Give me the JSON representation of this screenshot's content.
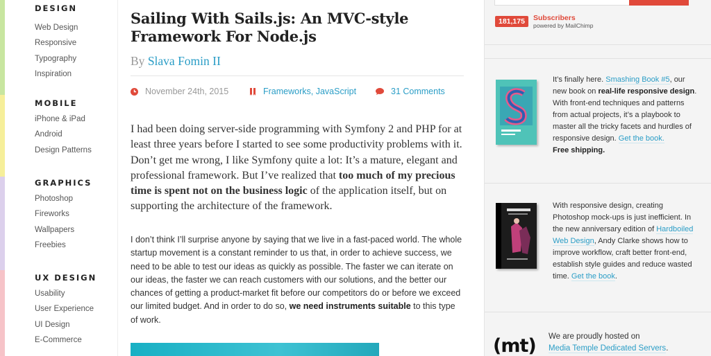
{
  "sidebar": {
    "sections": [
      {
        "heading": "DESIGN",
        "items": [
          "Web Design",
          "Responsive",
          "Typography",
          "Inspiration"
        ]
      },
      {
        "heading": "MOBILE",
        "items": [
          "iPhone & iPad",
          "Android",
          "Design Patterns"
        ]
      },
      {
        "heading": "GRAPHICS",
        "items": [
          "Photoshop",
          "Fireworks",
          "Wallpapers",
          "Freebies"
        ]
      },
      {
        "heading": "UX DESIGN",
        "items": [
          "Usability",
          "User Experience",
          "UI Design",
          "E-Commerce"
        ]
      }
    ],
    "colors": [
      "#c8e6a0",
      "#f6ef9a",
      "#dcd0ec",
      "#f6c3c8"
    ]
  },
  "article": {
    "title": "Sailing With Sails.js: An MVC-style Framework For Node.js",
    "by": "By",
    "author": "Slava Fomin II",
    "date": "November 24th, 2015",
    "categories": [
      "Frameworks",
      "JavaScript"
    ],
    "category_sep": ", ",
    "comments": "31 Comments",
    "lead_part1": "I had been doing server-side programming with Symfony 2 and PHP for at least three years before I started to see some productivity problems with it. Don’t get me wrong, I like Symfony quite a lot: It’s a mature, elegant and professional framework. But I’ve realized that ",
    "lead_bold": "too much of my precious time is spent not on the business logic",
    "lead_part2": " of the application itself, but on supporting the architecture of the framework.",
    "para_part1": "I don’t think I’ll surprise anyone by saying that we live in a fast-paced world. The whole startup movement is a constant reminder to us that, in order to achieve success, we need to be able to test our ideas as quickly as possible. The faster we can iterate on our ideas, the faster we can reach customers with our solutions, and the better our chances of getting a product-market fit before our competitors do or before we exceed our limited budget. And in order to do so, ",
    "para_bold": "we need instruments suitable",
    "para_part2": " to this type of work."
  },
  "newsletter": {
    "count": "181,175",
    "label": "Subscribers",
    "powered": "powered by MailChimp"
  },
  "promo1": {
    "p1": "It’s finally here. ",
    "link1": "Smashing Book #5",
    "p2": ", our new book on ",
    "bold1": "real-life responsive design",
    "p3": ". With front-end techniques and patterns from actual projects, it’s a playbook to master all the tricky facets and hurdles of responsive design. ",
    "link2": "Get the book.",
    "bold2": "Free shipping."
  },
  "promo2": {
    "p1": "With responsive design, creating Photoshop mock-ups is just inefficient. In the new anniversary edition of ",
    "link1": "Hardboiled Web Design",
    "p2": ", Andy Clarke shows how to improve workflow, craft better front-end, establish style guides and reduce wasted time. ",
    "link2": "Get the book",
    "p3": "."
  },
  "hosting": {
    "text": "We are proudly hosted on",
    "link": "Media Temple Dedicated Servers",
    "suffix": ".",
    "logo": "(mt)"
  },
  "colors": {
    "link": "#2a9dc6",
    "accent": "#e0493a",
    "icon_red": "#e0493a"
  },
  "icons": {
    "date": "clock-icon",
    "category": "bookmark-icon",
    "comments": "speech-bubble-icon"
  }
}
